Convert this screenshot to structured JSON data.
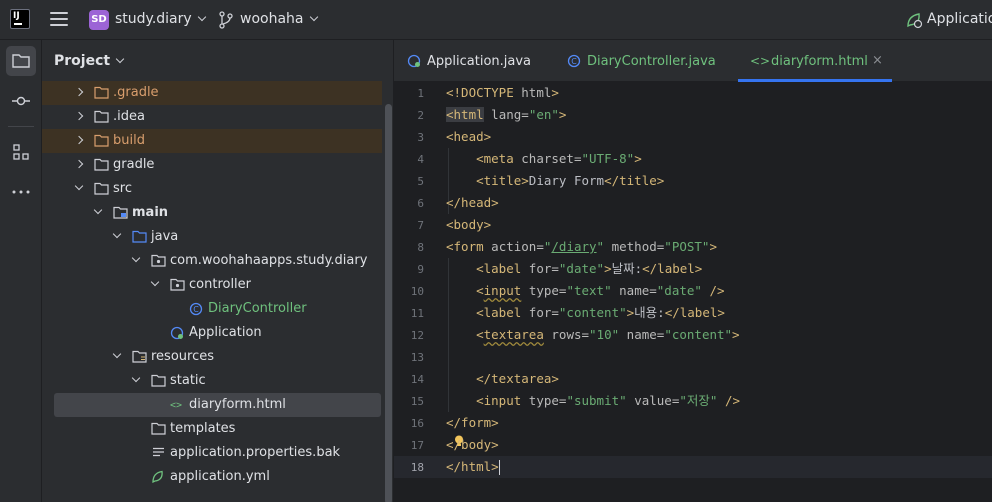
{
  "titlebar": {
    "logo_text": "IJ",
    "project_badge": "SD",
    "project_name": "study.diary",
    "branch": "woohaha",
    "run_config": "Application"
  },
  "project_panel": {
    "title": "Project",
    "items": [
      {
        "label": ".gradle",
        "type": "folder",
        "style": "excluded",
        "depth": 1,
        "expand": "right"
      },
      {
        "label": ".idea",
        "type": "folder",
        "style": "normal",
        "depth": 1,
        "expand": "right"
      },
      {
        "label": "build",
        "type": "folder",
        "style": "excluded",
        "depth": 1,
        "expand": "right"
      },
      {
        "label": "gradle",
        "type": "folder",
        "style": "normal",
        "depth": 1,
        "expand": "right"
      },
      {
        "label": "src",
        "type": "folder",
        "style": "normal",
        "depth": 1,
        "expand": "down"
      },
      {
        "label": "main",
        "type": "module-folder",
        "style": "bold",
        "depth": 2,
        "expand": "down"
      },
      {
        "label": "java",
        "type": "source-folder",
        "style": "normal",
        "depth": 3,
        "expand": "down"
      },
      {
        "label": "com.woohahaapps.study.diary",
        "type": "package",
        "style": "normal",
        "depth": 4,
        "expand": "down"
      },
      {
        "label": "controller",
        "type": "package",
        "style": "normal",
        "depth": 5,
        "expand": "down"
      },
      {
        "label": "DiaryController",
        "type": "class",
        "style": "green",
        "depth": 6,
        "expand": "none"
      },
      {
        "label": "Application",
        "type": "spring-class",
        "style": "normal",
        "depth": 5,
        "expand": "none"
      },
      {
        "label": "resources",
        "type": "resource-folder",
        "style": "normal",
        "depth": 3,
        "expand": "down"
      },
      {
        "label": "static",
        "type": "folder",
        "style": "normal",
        "depth": 4,
        "expand": "down"
      },
      {
        "label": "diaryform.html",
        "type": "html",
        "style": "selected",
        "depth": 5,
        "expand": "none"
      },
      {
        "label": "templates",
        "type": "folder",
        "style": "normal",
        "depth": 4,
        "expand": "none"
      },
      {
        "label": "application.properties.bak",
        "type": "text",
        "style": "normal",
        "depth": 4,
        "expand": "none"
      },
      {
        "label": "application.yml",
        "type": "yml",
        "style": "normal",
        "depth": 4,
        "expand": "none"
      }
    ]
  },
  "tabs": [
    {
      "label": "Application.java",
      "icon": "spring-class-icon",
      "active": false
    },
    {
      "label": "DiaryController.java",
      "icon": "class-icon",
      "active": false
    },
    {
      "label": "diaryform.html",
      "icon": "html-icon",
      "active": true,
      "close": "×"
    }
  ],
  "editor": {
    "current_line": 18,
    "line_numbers": [
      "1",
      "2",
      "3",
      "4",
      "5",
      "6",
      "7",
      "8",
      "9",
      "10",
      "11",
      "12",
      "13",
      "14",
      "15",
      "16",
      "17",
      "18"
    ]
  }
}
